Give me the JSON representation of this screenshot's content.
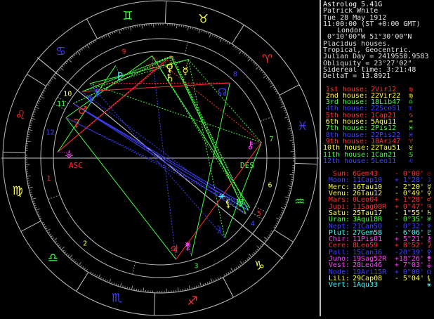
{
  "header": {
    "lines": [
      "Astrolog 5.41G",
      "Patrick White",
      "Tue 28 May 1912",
      "11:00:00 (ST +0:00 GMT)",
      "London",
      "0°10'00\"W 51°30'00\"N",
      "Placidus houses.",
      "Tropical, Geocentric.",
      "Julian Day = 2419550.9583",
      "Obliquity = 23°27'02\"",
      "Sidereal time: 3:21:48",
      "DeltaT = 13.8921"
    ]
  },
  "houses": [
    {
      "label": "1st house:",
      "value": "2Vir12",
      "symbol": "♍",
      "color": "#ff3030"
    },
    {
      "label": "2nd house:",
      "value": "22Vir22",
      "symbol": "♍",
      "color": "#ffff40"
    },
    {
      "label": "3rd house:",
      "value": "18Lib47",
      "symbol": "♎",
      "color": "#40ff40"
    },
    {
      "label": "4th house:",
      "value": "22Sco51",
      "symbol": "♏",
      "color": "#4040ff"
    },
    {
      "label": "5th house:",
      "value": "1Cap21",
      "symbol": "♑",
      "color": "#ff3030"
    },
    {
      "label": "6th house:",
      "value": "5Aqu11",
      "symbol": "♒",
      "color": "#ffff40"
    },
    {
      "label": "7th house:",
      "value": "2Pis12",
      "symbol": "♓",
      "color": "#40ff40"
    },
    {
      "label": "8th house:",
      "value": "22Pis22",
      "symbol": "♓",
      "color": "#4040ff"
    },
    {
      "label": "9th house:",
      "value": "18Ari47",
      "symbol": "♈",
      "color": "#ff3030"
    },
    {
      "label": "10th house:",
      "value": "22Tau51",
      "symbol": "♉",
      "color": "#ffff40"
    },
    {
      "label": "11th house:",
      "value": "1Can21",
      "symbol": "♋",
      "color": "#40ff40"
    },
    {
      "label": "12th house:",
      "value": "5Leo11",
      "symbol": "♌",
      "color": "#4040ff"
    }
  ],
  "planets": [
    {
      "name": "Sun:",
      "pos": "6Gem43",
      "lat": "- 0°00'",
      "symbol": "☉",
      "color": "#ff3030"
    },
    {
      "name": "Moon:",
      "pos": "11Cap10",
      "lat": "+ 1°28'",
      "symbol": "☽",
      "color": "#4040ff"
    },
    {
      "name": "Merc:",
      "pos": "16Tau10",
      "lat": "- 2°20'",
      "symbol": "☿",
      "color": "#ffff40"
    },
    {
      "name": "Venu:",
      "pos": "26Tau12",
      "lat": "- 0°49'",
      "symbol": "♀",
      "color": "#ffff40"
    },
    {
      "name": "Mars:",
      "pos": "0Leo04",
      "lat": "+ 1°28'",
      "symbol": "♂",
      "color": "#ff3030"
    },
    {
      "name": "Jupi:",
      "pos": "11Sag08R",
      "lat": "+ 0°47'",
      "symbol": "♃",
      "color": "#ff3030"
    },
    {
      "name": "Satu:",
      "pos": "25Tau17",
      "lat": "- 1°55'",
      "symbol": "♄",
      "color": "#ffff40"
    },
    {
      "name": "Uran:",
      "pos": "3Aqu18R",
      "lat": "- 0°35'",
      "symbol": "♅",
      "color": "#40ff40"
    },
    {
      "name": "Nept:",
      "pos": "21Can50",
      "lat": "- 0°32'",
      "symbol": "♆",
      "color": "#4040ff"
    },
    {
      "name": "Plut:",
      "pos": "27Gem58",
      "lat": "- 6°06'",
      "symbol": "♇",
      "color": "#40ffff"
    },
    {
      "name": "Chir:",
      "pos": "11Pis01",
      "lat": "+ 5°21'",
      "symbol": "⚷",
      "color": "#ff40ff"
    },
    {
      "name": "Cere:",
      "pos": "8Leo59",
      "lat": "+ 8°52'",
      "symbol": "⚳",
      "color": "#ff3030"
    },
    {
      "name": "Pall:",
      "pos": "15Can36",
      "lat": "-20°39'",
      "symbol": "⚴",
      "color": "#4040ff"
    },
    {
      "name": "Juno:",
      "pos": "19Sag52R",
      "lat": "+18°26'",
      "symbol": "⚵",
      "color": "#ff40ff"
    },
    {
      "name": "Vest:",
      "pos": "28Leo46",
      "lat": "+ 7°03'",
      "symbol": "⚶",
      "color": "#ff40ff"
    },
    {
      "name": "Node:",
      "pos": "19Ari15R",
      "lat": "+ 0°00'",
      "symbol": "☊",
      "color": "#4040ff"
    },
    {
      "name": "Lili:",
      "pos": "29Cap08",
      "lat": "- 5°04'",
      "symbol": "⚸",
      "color": "#ffff40"
    },
    {
      "name": "Vert:",
      "pos": "1Aqu33",
      "lat": "",
      "symbol": "⚹",
      "color": "#40ffff"
    }
  ],
  "wheel": {
    "house_numbers": [
      "1",
      "2",
      "3",
      "4",
      "5",
      "6",
      "7",
      "8",
      "9",
      "10",
      "11",
      "12"
    ],
    "angle_labels": {
      "asc": "ASC",
      "des": "DES"
    },
    "sign_symbols": [
      {
        "sign": "aries",
        "symbol": "♈",
        "color": "#ff3030"
      },
      {
        "sign": "taurus",
        "symbol": "♉",
        "color": "#ffff40"
      },
      {
        "sign": "gemini",
        "symbol": "♊",
        "color": "#40ff40"
      },
      {
        "sign": "cancer",
        "symbol": "♋",
        "color": "#4040ff"
      },
      {
        "sign": "leo",
        "symbol": "♌",
        "color": "#ff3030"
      },
      {
        "sign": "virgo",
        "symbol": "♍",
        "color": "#ffff40"
      },
      {
        "sign": "libra",
        "symbol": "♎",
        "color": "#40ff40"
      },
      {
        "sign": "scorpio",
        "symbol": "♏",
        "color": "#4040ff"
      },
      {
        "sign": "sagittarius",
        "symbol": "♐",
        "color": "#ff3030"
      },
      {
        "sign": "capricorn",
        "symbol": "♑",
        "color": "#ffff40"
      },
      {
        "sign": "aquarius",
        "symbol": "♒",
        "color": "#40ff40"
      },
      {
        "sign": "pisces",
        "symbol": "♓",
        "color": "#4040ff"
      }
    ],
    "house_cusps": [
      152.2,
      172.4,
      228.8,
      292.9,
      301.4,
      305.2,
      332.2,
      352.4,
      48.8,
      112.9,
      121.4,
      125.2
    ],
    "planet_longitudes": [
      66.7,
      281.2,
      46.2,
      56.2,
      120.1,
      251.1,
      55.3,
      303.3,
      111.8,
      88.0,
      341.0,
      129.0,
      105.6,
      259.9,
      148.8,
      19.3,
      299.1,
      301.6
    ]
  }
}
